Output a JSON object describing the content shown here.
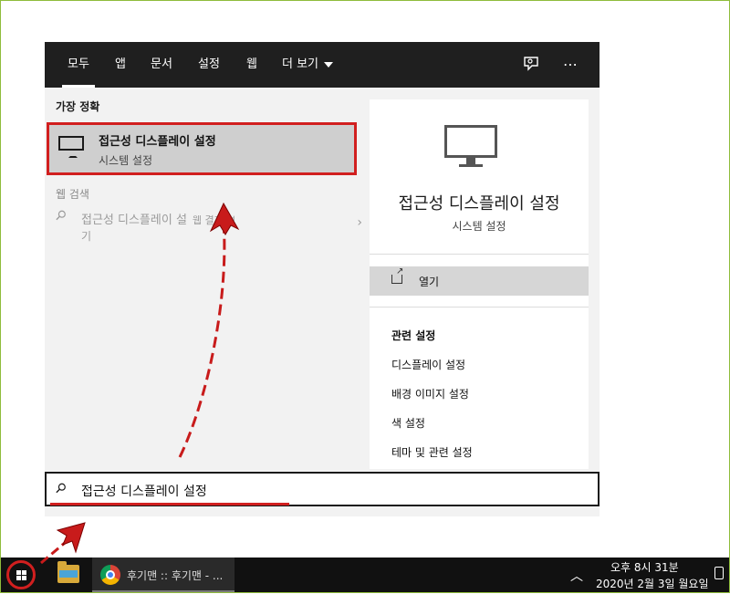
{
  "tabs": [
    {
      "label": "모두",
      "active": true
    },
    {
      "label": "앱"
    },
    {
      "label": "문서"
    },
    {
      "label": "설정"
    },
    {
      "label": "웹"
    },
    {
      "label": "더 보기"
    }
  ],
  "topbar_icons": [
    "feedback-icon",
    "more-options-icon"
  ],
  "left": {
    "best_match_label": "가장 정확",
    "best_match": {
      "title": "접근성 디스플레이 설정",
      "subtitle": "시스템 설정",
      "icon": "monitor-icon"
    },
    "web_search_label": "웹 검색",
    "web_item": {
      "query": "접근성 디스플레이 설",
      "suffix": "웹 결과 보",
      "suffix2": "기"
    }
  },
  "right": {
    "title": "접근성 디스플레이 설정",
    "subtitle": "시스템 설정",
    "open_label": "열기",
    "related_heading": "관련 설정",
    "related": [
      "디스플레이 설정",
      "배경 이미지 설정",
      "색 설정",
      "테마 및 관련 설정"
    ]
  },
  "search": {
    "value": "접근성 디스플레이 설정"
  },
  "taskbar": {
    "chrome_label": "후기맨 :: 후기맨 - ...",
    "time": "오후 8시 31분",
    "date": "2020년 2월 3일 월요일"
  },
  "colors": {
    "highlight": "#d11f1f",
    "topbar": "#1f1f1f",
    "taskbar": "#111111"
  }
}
